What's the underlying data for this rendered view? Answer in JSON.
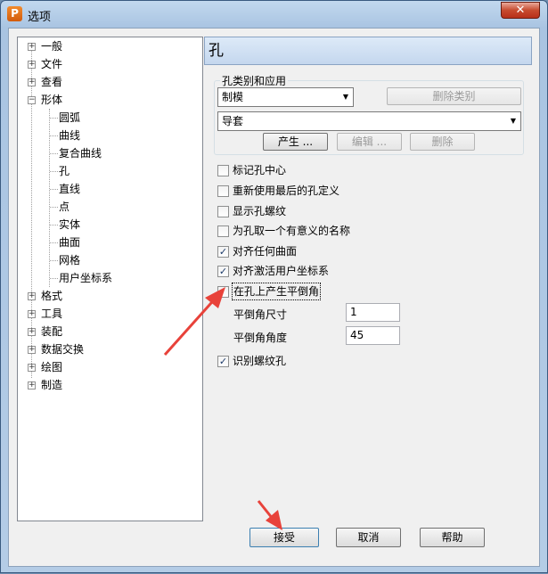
{
  "window": {
    "title": "选项",
    "app_icon_letter": "P",
    "close_glyph": "✕"
  },
  "tree": {
    "collapse_glyph": "−",
    "expand_glyph": "+",
    "top": [
      {
        "label": "一般",
        "state": "collapsed"
      },
      {
        "label": "文件",
        "state": "collapsed"
      },
      {
        "label": "查看",
        "state": "collapsed"
      },
      {
        "label": "形体",
        "state": "expanded"
      }
    ],
    "children": [
      "圆弧",
      "曲线",
      "复合曲线",
      "孔",
      "直线",
      "点",
      "实体",
      "曲面",
      "网格",
      "用户坐标系"
    ],
    "bottom": [
      "格式",
      "工具",
      "装配",
      "数据交换",
      "绘图",
      "制造"
    ]
  },
  "panel": {
    "header": "孔",
    "group_title": "孔类别和应用",
    "category_value": "制模",
    "delete_category_label": "删除类别",
    "application_value": "导套",
    "create_label": "产生 ...",
    "edit_label": "编辑 ...",
    "delete_label": "删除",
    "check_glyph": "✓",
    "options": [
      {
        "label": "标记孔中心",
        "checked": false
      },
      {
        "label": "重新使用最后的孔定义",
        "checked": false
      },
      {
        "label": "显示孔螺纹",
        "checked": false
      },
      {
        "label": "为孔取一个有意义的名称",
        "checked": false
      },
      {
        "label": "对齐任何曲面",
        "checked": true
      },
      {
        "label": "对齐激活用户坐标系",
        "checked": true
      },
      {
        "label": "在孔上产生平倒角",
        "checked": false
      }
    ],
    "chamfer_size_label": "平倒角尺寸",
    "chamfer_size_value": "1",
    "chamfer_angle_label": "平倒角角度",
    "chamfer_angle_value": "45",
    "identify_thread_label": "识别螺纹孔",
    "identify_thread_checked": true
  },
  "footer": {
    "accept_label": "接受",
    "cancel_label": "取消",
    "help_label": "帮助"
  },
  "annotation_color": "#e8423a"
}
